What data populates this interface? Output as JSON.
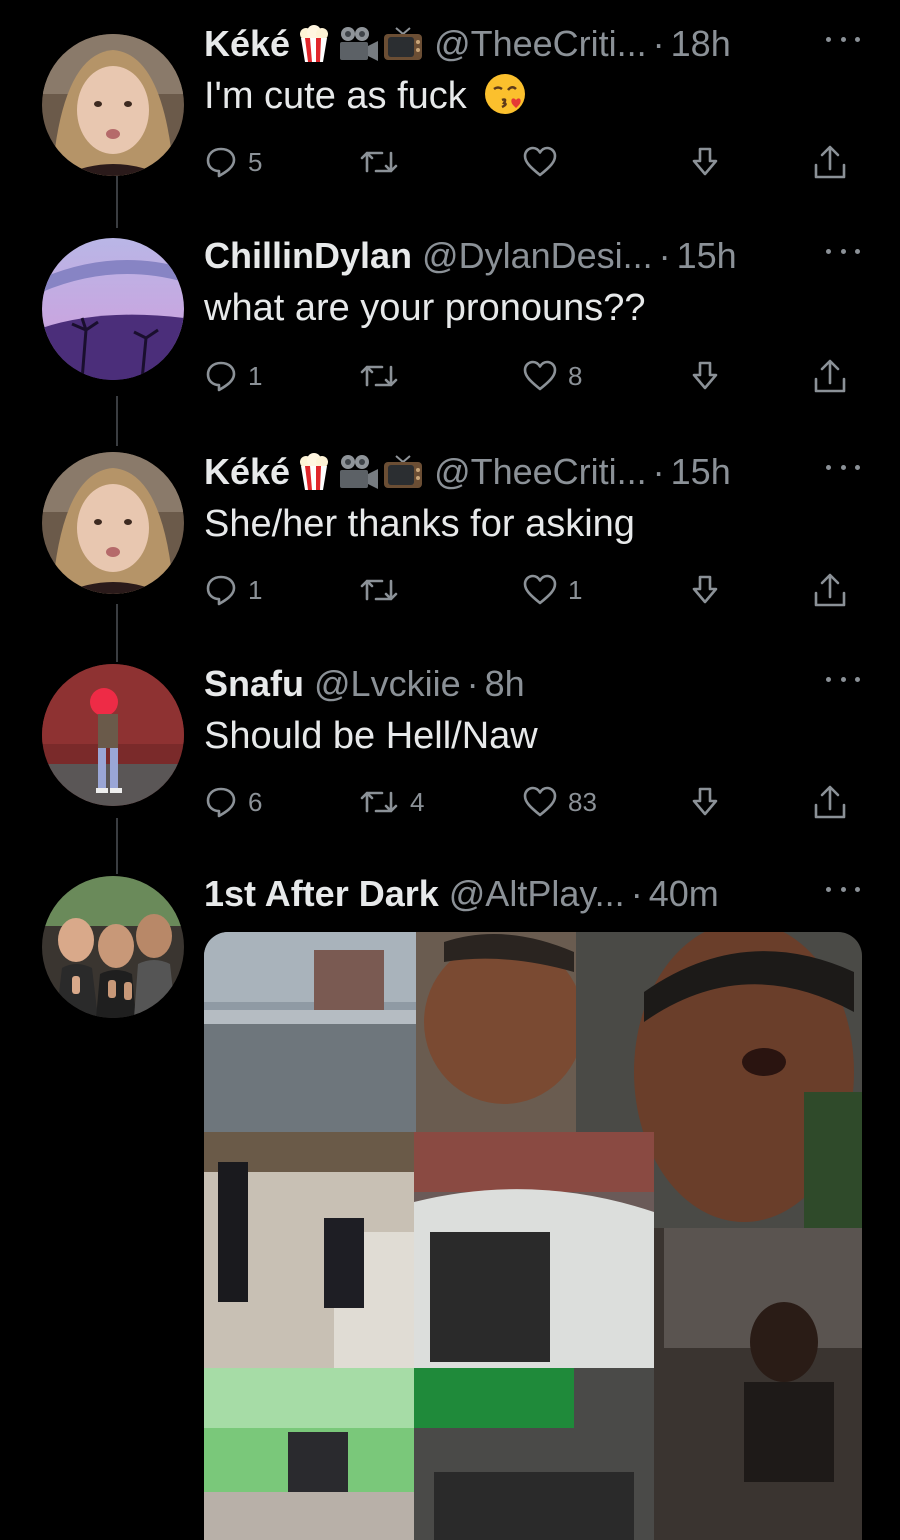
{
  "thread": [
    {
      "name": "Kéké",
      "emojis": [
        "popcorn-icon",
        "movie-camera-icon",
        "television-icon"
      ],
      "handle": "@TheeCriti...",
      "time": "18h",
      "text": "I'm cute as fuck",
      "text_emoji": "kissing-face-icon",
      "replies": "5",
      "retweets": "",
      "likes": ""
    },
    {
      "name": "ChillinDylan",
      "handle": "@DylanDesi...",
      "time": "15h",
      "text": "what are your pronouns??",
      "replies": "1",
      "retweets": "",
      "likes": "8"
    },
    {
      "name": "Kéké",
      "emojis": [
        "popcorn-icon",
        "movie-camera-icon",
        "television-icon"
      ],
      "handle": "@TheeCriti...",
      "time": "15h",
      "text": "She/her thanks for asking",
      "replies": "1",
      "retweets": "",
      "likes": "1"
    },
    {
      "name": "Snafu",
      "handle": "@Lvckiie",
      "time": "8h",
      "text": "Should be Hell/Naw",
      "replies": "6",
      "retweets": "4",
      "likes": "83"
    },
    {
      "name": "1st After Dark",
      "handle": "@AltPlay...",
      "time": "40m",
      "text": ""
    }
  ],
  "separator": "·",
  "colors": {
    "background": "#000000",
    "text": "#e7e9ea",
    "muted": "#8b9197",
    "thread_line": "#3a3d41"
  }
}
